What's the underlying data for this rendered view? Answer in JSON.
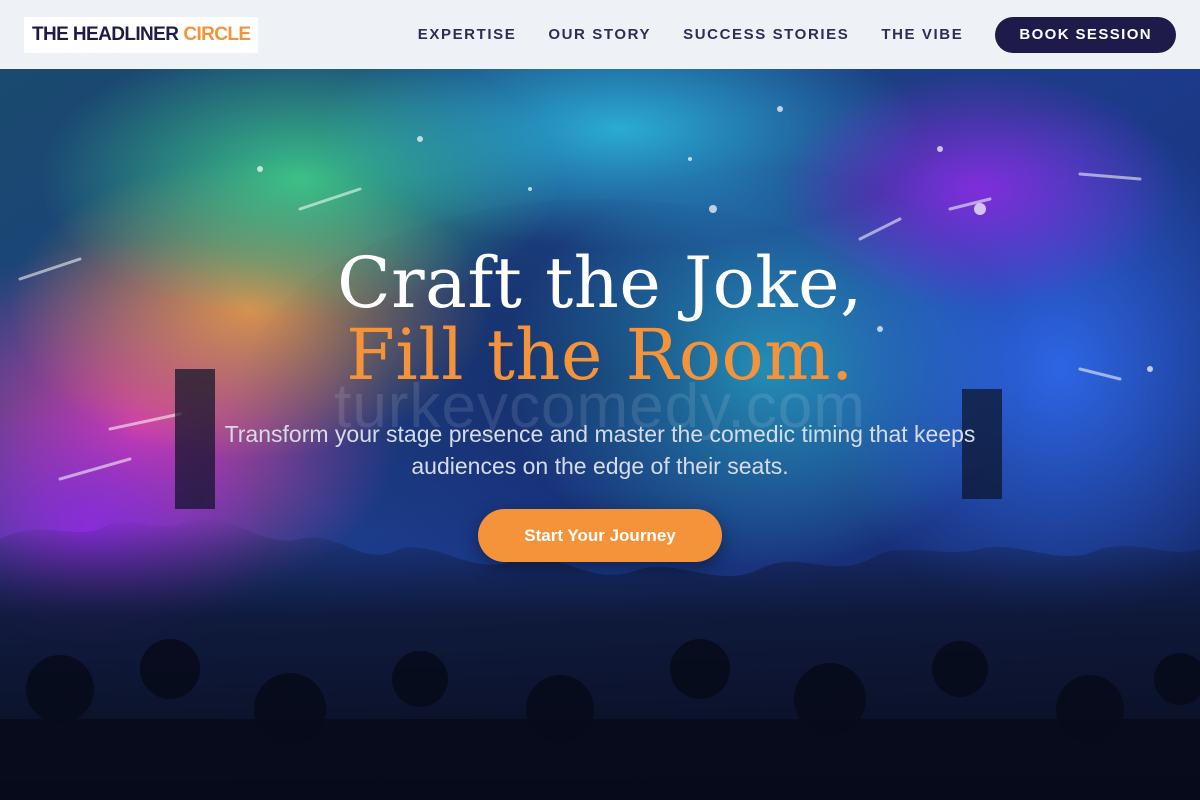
{
  "brand": {
    "name_main": "THE HEADLINER",
    "name_accent": "CIRCLE"
  },
  "nav": {
    "items": [
      {
        "label": "EXPERTISE"
      },
      {
        "label": "OUR STORY"
      },
      {
        "label": "SUCCESS STORIES"
      },
      {
        "label": "THE VIBE"
      }
    ],
    "cta_label": "BOOK SESSION"
  },
  "hero": {
    "headline_line1": "Craft the Joke,",
    "headline_line2": "Fill the Room.",
    "watermark": "turkeycomedy.com",
    "subtext": "Transform your stage presence and master the comedic timing that keeps audiences on the edge of their seats.",
    "cta_label": "Start Your Journey"
  },
  "colors": {
    "brand_dark": "#1e1b4b",
    "accent_orange": "#f5933a",
    "header_bg": "#eef1f5"
  },
  "icons": {
    "hero_background": "concert-crowd-photo"
  }
}
